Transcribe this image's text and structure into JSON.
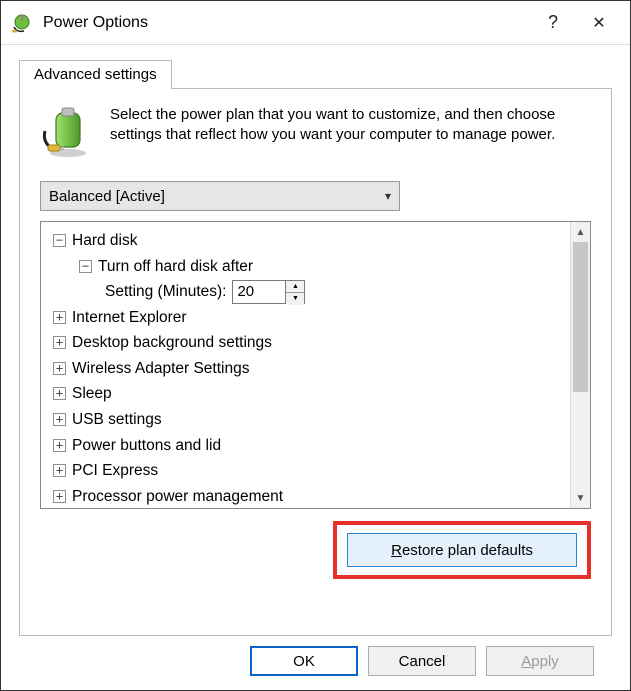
{
  "window": {
    "title": "Power Options",
    "help_symbol": "?",
    "close_symbol": "✕"
  },
  "tab": {
    "label": "Advanced settings"
  },
  "intro": {
    "text": "Select the power plan that you want to customize, and then choose settings that reflect how you want your computer to manage power."
  },
  "plan": {
    "selected": "Balanced [Active]"
  },
  "tree": {
    "hard_disk": "Hard disk",
    "turn_off": "Turn off hard disk after",
    "setting_label": "Setting (Minutes):",
    "setting_value": "20",
    "items": {
      "ie": "Internet Explorer",
      "desktop_bg": "Desktop background settings",
      "wireless": "Wireless Adapter Settings",
      "sleep": "Sleep",
      "usb": "USB settings",
      "power_buttons": "Power buttons and lid",
      "pci": "PCI Express",
      "processor": "Processor power management"
    }
  },
  "restore": {
    "prefix": "R",
    "rest": "estore plan defaults"
  },
  "buttons": {
    "ok": "OK",
    "cancel": "Cancel",
    "apply_prefix": "A",
    "apply_rest": "pply"
  }
}
